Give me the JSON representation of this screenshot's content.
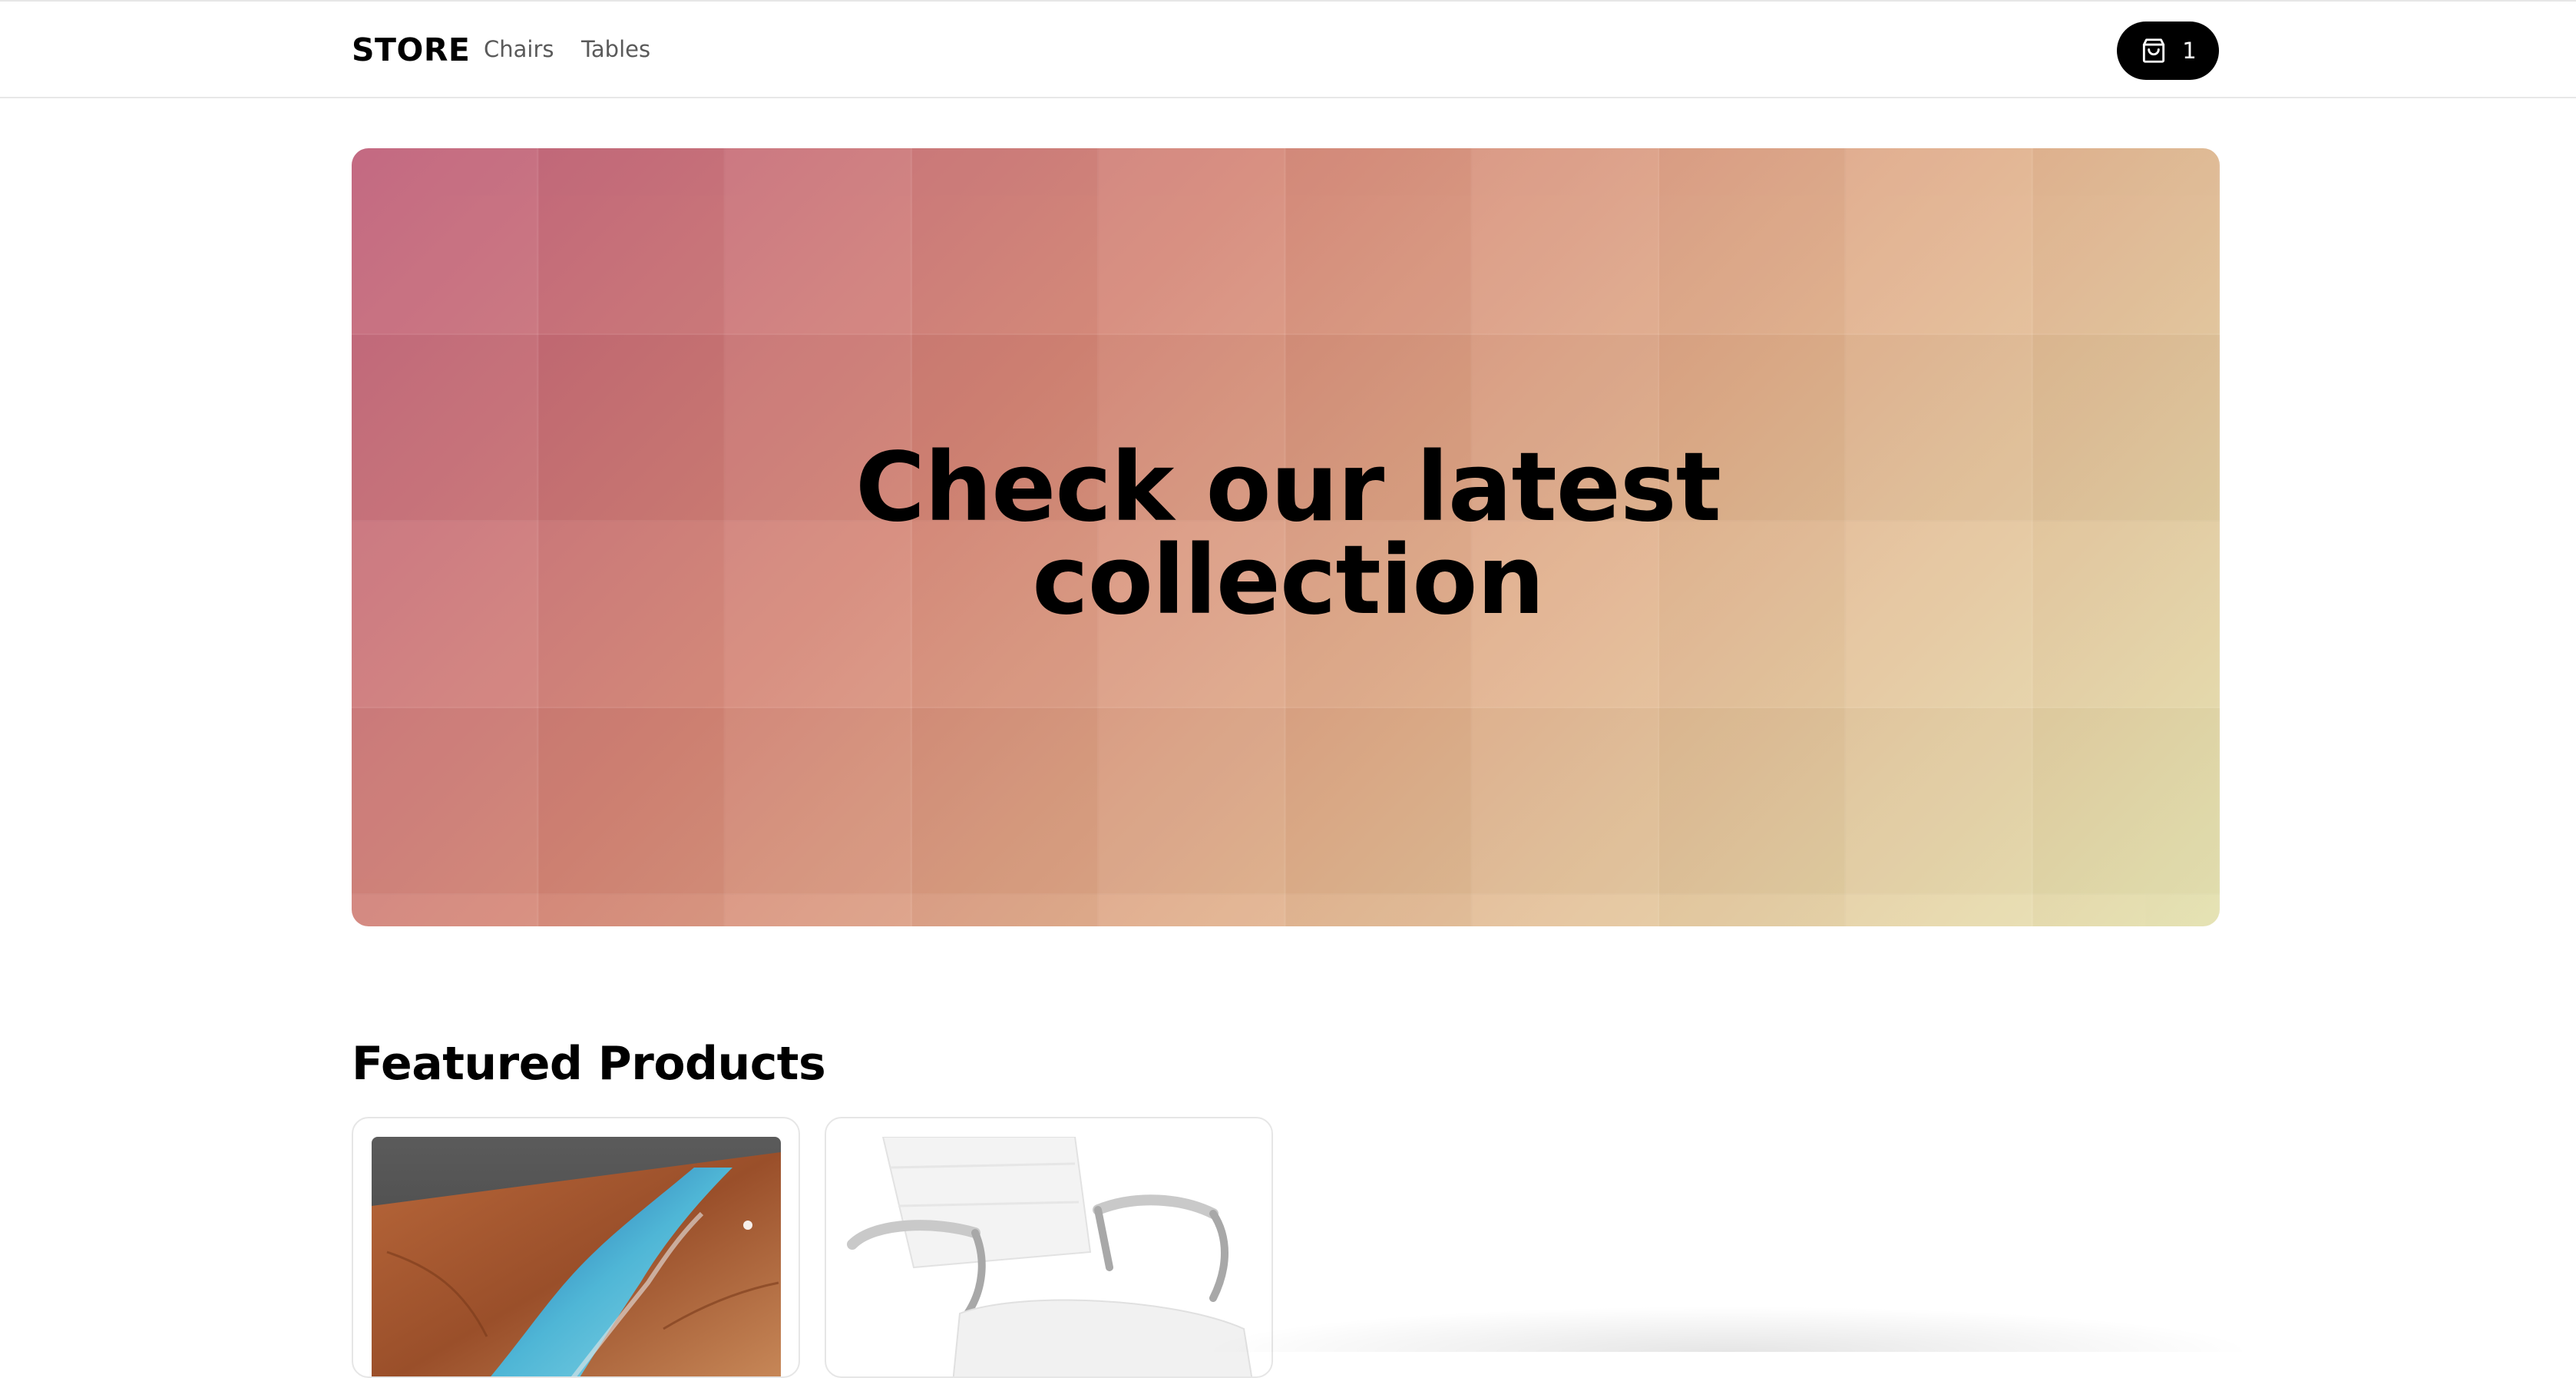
{
  "header": {
    "brand": "STORE",
    "nav": [
      {
        "label": "Chairs"
      },
      {
        "label": "Tables"
      }
    ],
    "cart": {
      "icon": "shopping-bag-icon",
      "count": "1"
    }
  },
  "hero": {
    "title_line1": "Check our latest",
    "title_line2": "collection",
    "gradient_colors": [
      "#bd5a75",
      "#d48575",
      "#e0ae8a",
      "#e8e6b4"
    ]
  },
  "featured": {
    "title": "Featured Products",
    "products": [
      {
        "image": "resin-river-table-image"
      },
      {
        "image": "white-office-chair-image"
      }
    ]
  }
}
